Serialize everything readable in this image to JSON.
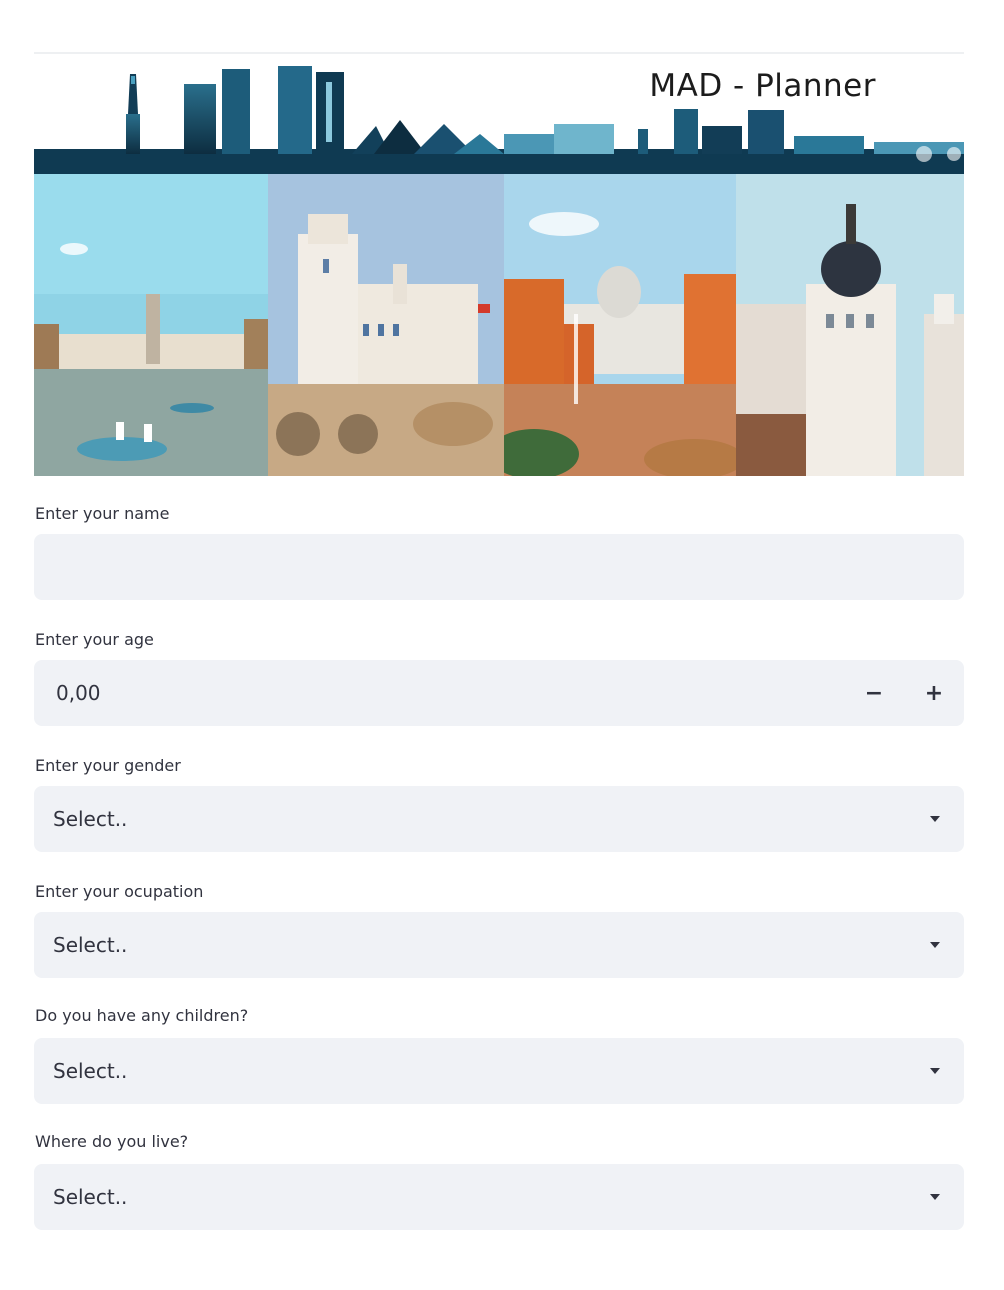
{
  "header": {
    "title": "MAD - Planner"
  },
  "banner": {
    "photos": [
      "retiro-park-monument",
      "cibeles-palace",
      "crystal-palace",
      "metropolis-building"
    ]
  },
  "form": {
    "name": {
      "label": "Enter your name",
      "value": "",
      "placeholder": ""
    },
    "age": {
      "label": "Enter your age",
      "value": "0,00",
      "decrement_label": "−",
      "increment_label": "+"
    },
    "gender": {
      "label": "Enter your gender",
      "selected": "Select.."
    },
    "occupation": {
      "label": "Enter your ocupation",
      "selected": "Select.."
    },
    "children": {
      "label": "Do you have any children?",
      "selected": "Select.."
    },
    "residence": {
      "label": "Where do you live?",
      "selected": "Select.."
    }
  },
  "colors": {
    "input_background": "#f0f2f6",
    "text": "#31333f"
  }
}
